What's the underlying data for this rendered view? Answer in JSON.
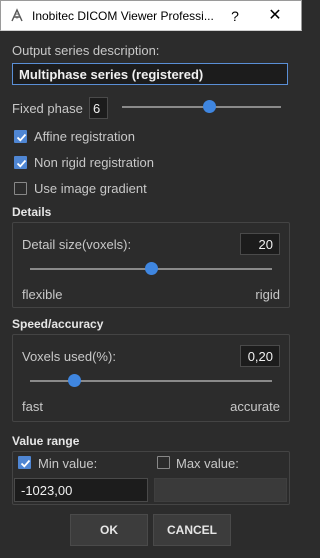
{
  "window": {
    "title": "Inobitec DICOM Viewer Professi...",
    "help_glyph": "?",
    "close_glyph": "✕"
  },
  "output": {
    "label": "Output series description:",
    "value": "Multiphase series (registered)"
  },
  "fixed_phase": {
    "label": "Fixed phase",
    "value": "6",
    "slider_fraction": 0.55
  },
  "options": [
    {
      "label": "Affine registration",
      "checked": true
    },
    {
      "label": "Non rigid registration",
      "checked": true
    },
    {
      "label": "Use image gradient",
      "checked": false
    }
  ],
  "details": {
    "title": "Details",
    "field_label": "Detail size(voxels):",
    "value": "20",
    "slider_fraction": 0.5,
    "min_label": "flexible",
    "max_label": "rigid"
  },
  "speed": {
    "title": "Speed/accuracy",
    "field_label": "Voxels used(%):",
    "value": "0,20",
    "slider_fraction": 0.18,
    "min_label": "fast",
    "max_label": "accurate"
  },
  "value_range": {
    "title": "Value range",
    "min_label": "Min value:",
    "min_checked": true,
    "min_value": "-1023,00",
    "max_label": "Max value:",
    "max_checked": false,
    "max_value": ""
  },
  "buttons": {
    "ok": "OK",
    "cancel": "CANCEL"
  },
  "colors": {
    "accent": "#4f86d3",
    "background": "#2c2c2c"
  }
}
